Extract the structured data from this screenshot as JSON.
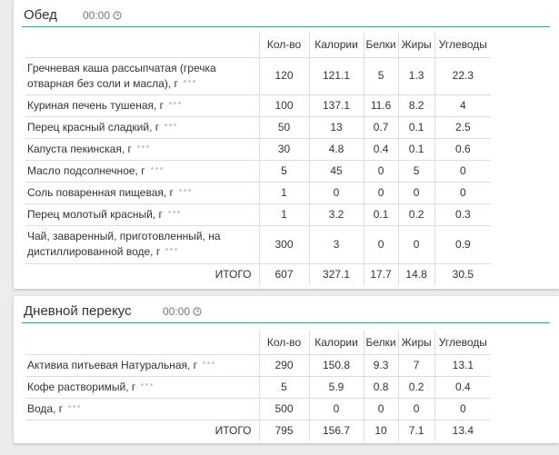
{
  "columns": [
    "Кол-во",
    "Калории",
    "Белки",
    "Жиры",
    "Углеводы"
  ],
  "total_label": "ИТОГО",
  "meals": [
    {
      "title": "Обед",
      "time": "00:00",
      "items": [
        {
          "name": "Гречневая каша рассыпчатая (гречка отварная без соли и масла), г",
          "qty": "120",
          "cal": "121.1",
          "prot": "5",
          "fat": "1.3",
          "carb": "22.3"
        },
        {
          "name": "Куриная печень тушеная, г",
          "qty": "100",
          "cal": "137.1",
          "prot": "11.6",
          "fat": "8.2",
          "carb": "4"
        },
        {
          "name": "Перец красный сладкий, г",
          "qty": "50",
          "cal": "13",
          "prot": "0.7",
          "fat": "0.1",
          "carb": "2.5"
        },
        {
          "name": "Капуста пекинская, г",
          "qty": "30",
          "cal": "4.8",
          "prot": "0.4",
          "fat": "0.1",
          "carb": "0.6"
        },
        {
          "name": "Масло подсолнечное, г",
          "qty": "5",
          "cal": "45",
          "prot": "0",
          "fat": "5",
          "carb": "0"
        },
        {
          "name": "Соль поваренная пищевая, г",
          "qty": "1",
          "cal": "0",
          "prot": "0",
          "fat": "0",
          "carb": "0"
        },
        {
          "name": "Перец молотый красный, г",
          "qty": "1",
          "cal": "3.2",
          "prot": "0.1",
          "fat": "0.2",
          "carb": "0.3"
        },
        {
          "name": "Чай, заваренный, приготовленный, на дистиллированной воде, г",
          "qty": "300",
          "cal": "3",
          "prot": "0",
          "fat": "0",
          "carb": "0.9"
        }
      ],
      "total": {
        "qty": "607",
        "cal": "327.1",
        "prot": "17.7",
        "fat": "14.8",
        "carb": "30.5"
      }
    },
    {
      "title": "Дневной перекус",
      "time": "00:00",
      "items": [
        {
          "name": "Активиа питьевая Натуральная, г",
          "qty": "290",
          "cal": "150.8",
          "prot": "9.3",
          "fat": "7",
          "carb": "13.1"
        },
        {
          "name": "Кофе растворимый, г",
          "qty": "5",
          "cal": "5.9",
          "prot": "0.8",
          "fat": "0.2",
          "carb": "0.4"
        },
        {
          "name": "Вода, г",
          "qty": "500",
          "cal": "0",
          "prot": "0",
          "fat": "0",
          "carb": "0"
        }
      ],
      "total": {
        "qty": "795",
        "cal": "156.7",
        "prot": "10",
        "fat": "7.1",
        "carb": "13.4"
      }
    }
  ],
  "icons": {
    "clock": "clock-icon",
    "more": "more-dots-icon"
  },
  "colors": {
    "accent": "#1fa79b",
    "dots": "#c8c8dc",
    "border": "#ddd"
  }
}
